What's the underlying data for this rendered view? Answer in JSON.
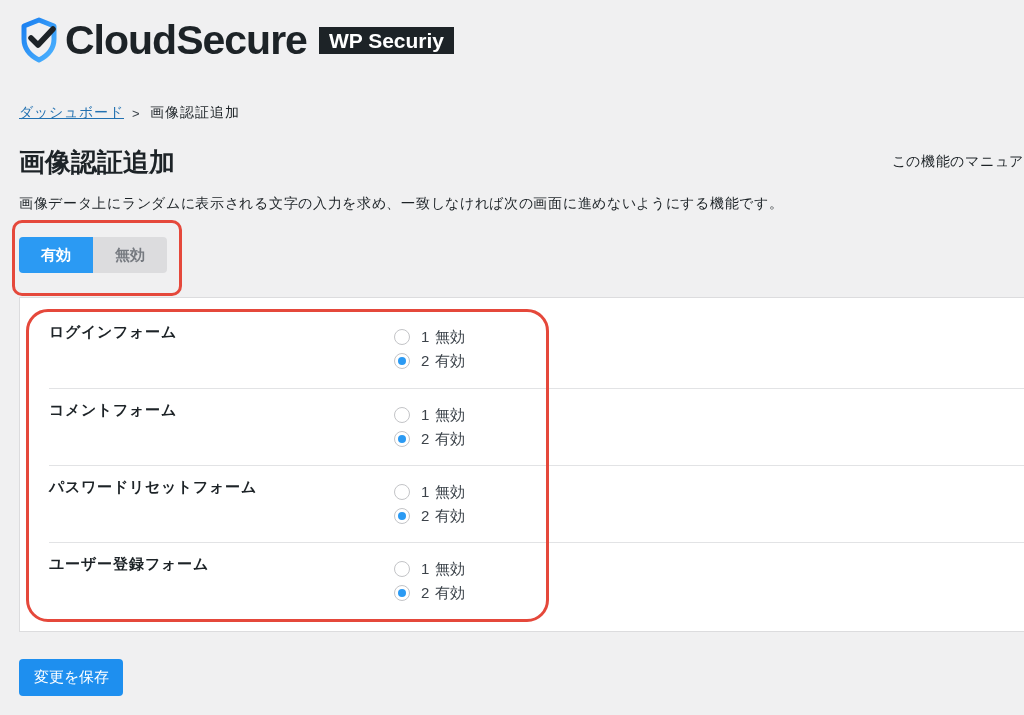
{
  "logo": {
    "brand": "CloudSecure",
    "badge": "WP Securiy"
  },
  "breadcrumb": {
    "items": [
      {
        "label": "ダッシュボード",
        "kind": "link"
      },
      {
        "label": "画像認証追加",
        "kind": "current"
      }
    ],
    "separator": ">"
  },
  "page": {
    "title": "画像認証追加",
    "manual_link": "この機能のマニュア",
    "description": "画像データ上にランダムに表示される文字の入力を求め、一致しなければ次の画面に進めないようにする機能です。"
  },
  "toggle": {
    "highlighted": true,
    "options": [
      {
        "label": "有効",
        "selected": true
      },
      {
        "label": "無効",
        "selected": false
      }
    ]
  },
  "settings": {
    "highlighted": true,
    "rows": [
      {
        "label": "ログインフォーム",
        "options": [
          {
            "label": "1 無効",
            "selected": false
          },
          {
            "label": "2 有効",
            "selected": true
          }
        ]
      },
      {
        "label": "コメントフォーム",
        "options": [
          {
            "label": "1 無効",
            "selected": false
          },
          {
            "label": "2 有効",
            "selected": true
          }
        ]
      },
      {
        "label": "パスワードリセットフォーム",
        "options": [
          {
            "label": "1 無効",
            "selected": false
          },
          {
            "label": "2 有効",
            "selected": true
          }
        ]
      },
      {
        "label": "ユーザー登録フォーム",
        "options": [
          {
            "label": "1 無効",
            "selected": false
          },
          {
            "label": "2 有効",
            "selected": true
          }
        ]
      }
    ]
  },
  "save_button": "変更を保存"
}
